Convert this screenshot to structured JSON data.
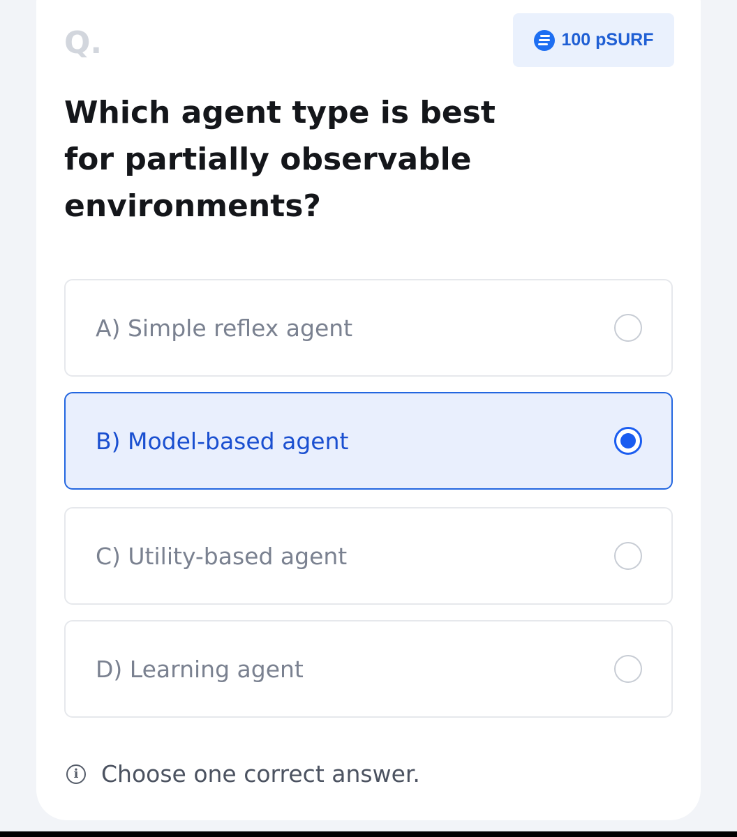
{
  "header": {
    "question_marker": "Q.",
    "reward": {
      "icon": "coin-icon",
      "text": "100 pSURF",
      "accent_color": "#1e6ff2"
    }
  },
  "question": {
    "text": "Which agent type is best for partially observable environments?"
  },
  "options": [
    {
      "label": "A) Simple reflex agent",
      "selected": false
    },
    {
      "label": "B) Model-based agent",
      "selected": true
    },
    {
      "label": "C) Utility-based agent",
      "selected": false
    },
    {
      "label": "D) Learning agent",
      "selected": false
    }
  ],
  "hint": {
    "icon": "info-icon",
    "text": "Choose one correct answer."
  },
  "colors": {
    "selected_border": "#2366e0",
    "selected_background": "#e9effd",
    "selected_text": "#1a4fd0"
  }
}
